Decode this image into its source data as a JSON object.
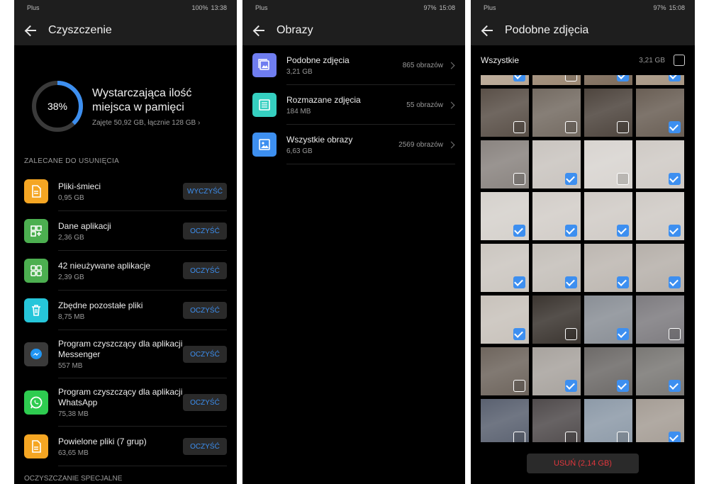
{
  "panel1": {
    "status": {
      "carrier": "Plus",
      "battery": "100%",
      "time": "13:38"
    },
    "title": "Czyszczenie",
    "storage": {
      "percent_label": "38%",
      "percent": 0.38,
      "title": "Wystarczająca ilość miejsca w pamięci",
      "subtitle": "Zajęte 50,92 GB, łącznie 128 GB"
    },
    "section_recommended": "ZALECANE DO USUNIĘCIA",
    "items": [
      {
        "name": "Pliki-śmieci",
        "size": "0,95 GB",
        "button": "WYCZYŚĆ",
        "icon": "file-icon",
        "color": "#f5a623"
      },
      {
        "name": "Dane aplikacji",
        "size": "2,36 GB",
        "button": "OCZYŚĆ",
        "icon": "app-data-icon",
        "color": "#4caf50"
      },
      {
        "name": "42 nieużywane aplikacje",
        "size": "2,39 GB",
        "button": "OCZYŚĆ",
        "icon": "apps-grid-icon",
        "color": "#4caf50"
      },
      {
        "name": "Zbędne pozostałe pliki",
        "size": "8,75 MB",
        "button": "OCZYŚĆ",
        "icon": "trash-icon",
        "color": "#26c6da"
      },
      {
        "name": "Program czyszczący dla aplikacji Messenger",
        "size": "557 MB",
        "button": "OCZYŚĆ",
        "icon": "messenger-icon",
        "color": "#3a3a3a"
      },
      {
        "name": "Program czyszczący dla aplikacji WhatsApp",
        "size": "75,38 MB",
        "button": "OCZYŚĆ",
        "icon": "whatsapp-icon",
        "color": "#2ecc50"
      },
      {
        "name": "Powielone pliki (7 grup)",
        "size": "63,65 MB",
        "button": "OCZYŚĆ",
        "icon": "duplicate-file-icon",
        "color": "#f5a623"
      }
    ],
    "section_special": "OCZYSZCZANIE SPECJALNE"
  },
  "panel2": {
    "status": {
      "carrier": "Plus",
      "battery": "97%",
      "time": "15:08"
    },
    "title": "Obrazy",
    "albums": [
      {
        "name": "Podobne zdjęcia",
        "size": "3,21 GB",
        "count": "865 obrazów",
        "icon": "similar-photos-icon",
        "color": "#6f7df0"
      },
      {
        "name": "Rozmazane zdjęcia",
        "size": "184 MB",
        "count": "55 obrazów",
        "icon": "blurry-photos-icon",
        "color": "#35cfc0"
      },
      {
        "name": "Wszystkie obrazy",
        "size": "6,63 GB",
        "count": "2569 obrazów",
        "icon": "all-photos-icon",
        "color": "#3d8ff0"
      }
    ]
  },
  "panel3": {
    "status": {
      "carrier": "Plus",
      "battery": "97%",
      "time": "15:08"
    },
    "title": "Podobne zdjęcia",
    "all_label": "Wszystkie",
    "all_size": "3,21 GB",
    "delete_label": "USUŃ (2,14 GB)",
    "grid_checked": [
      [
        true,
        false,
        true,
        true
      ],
      [
        false,
        false,
        false,
        true
      ],
      [
        false,
        true,
        false,
        true
      ],
      [
        true,
        true,
        true,
        true
      ],
      [
        true,
        true,
        true,
        true
      ],
      [
        true,
        false,
        true,
        false
      ],
      [
        false,
        true,
        true,
        true
      ],
      [
        false,
        false,
        false,
        true
      ]
    ],
    "grid_colors": [
      [
        "#b7a592",
        "#9c8873",
        "#7d6b5a",
        "#a69582"
      ],
      [
        "#5a5048",
        "#746b62",
        "#4e453e",
        "#6a5f55"
      ],
      [
        "#8a8480",
        "#c9c4bf",
        "#d8d4d0",
        "#cfcac5"
      ],
      [
        "#d5d1cc",
        "#d2cdc8",
        "#d0cbc6",
        "#cfcac5"
      ],
      [
        "#cbc6c0",
        "#c4bfb9",
        "#bdb7b1",
        "#b6b0aa"
      ],
      [
        "#c8c2bb",
        "#3b3530",
        "#8a8f96",
        "#7e7c80"
      ],
      [
        "#6e655d",
        "#a8a39e",
        "#6d6a68",
        "#7a7875"
      ],
      [
        "#5a6170",
        "#504b4c",
        "#8d9aa8",
        "#a59d95"
      ]
    ]
  }
}
